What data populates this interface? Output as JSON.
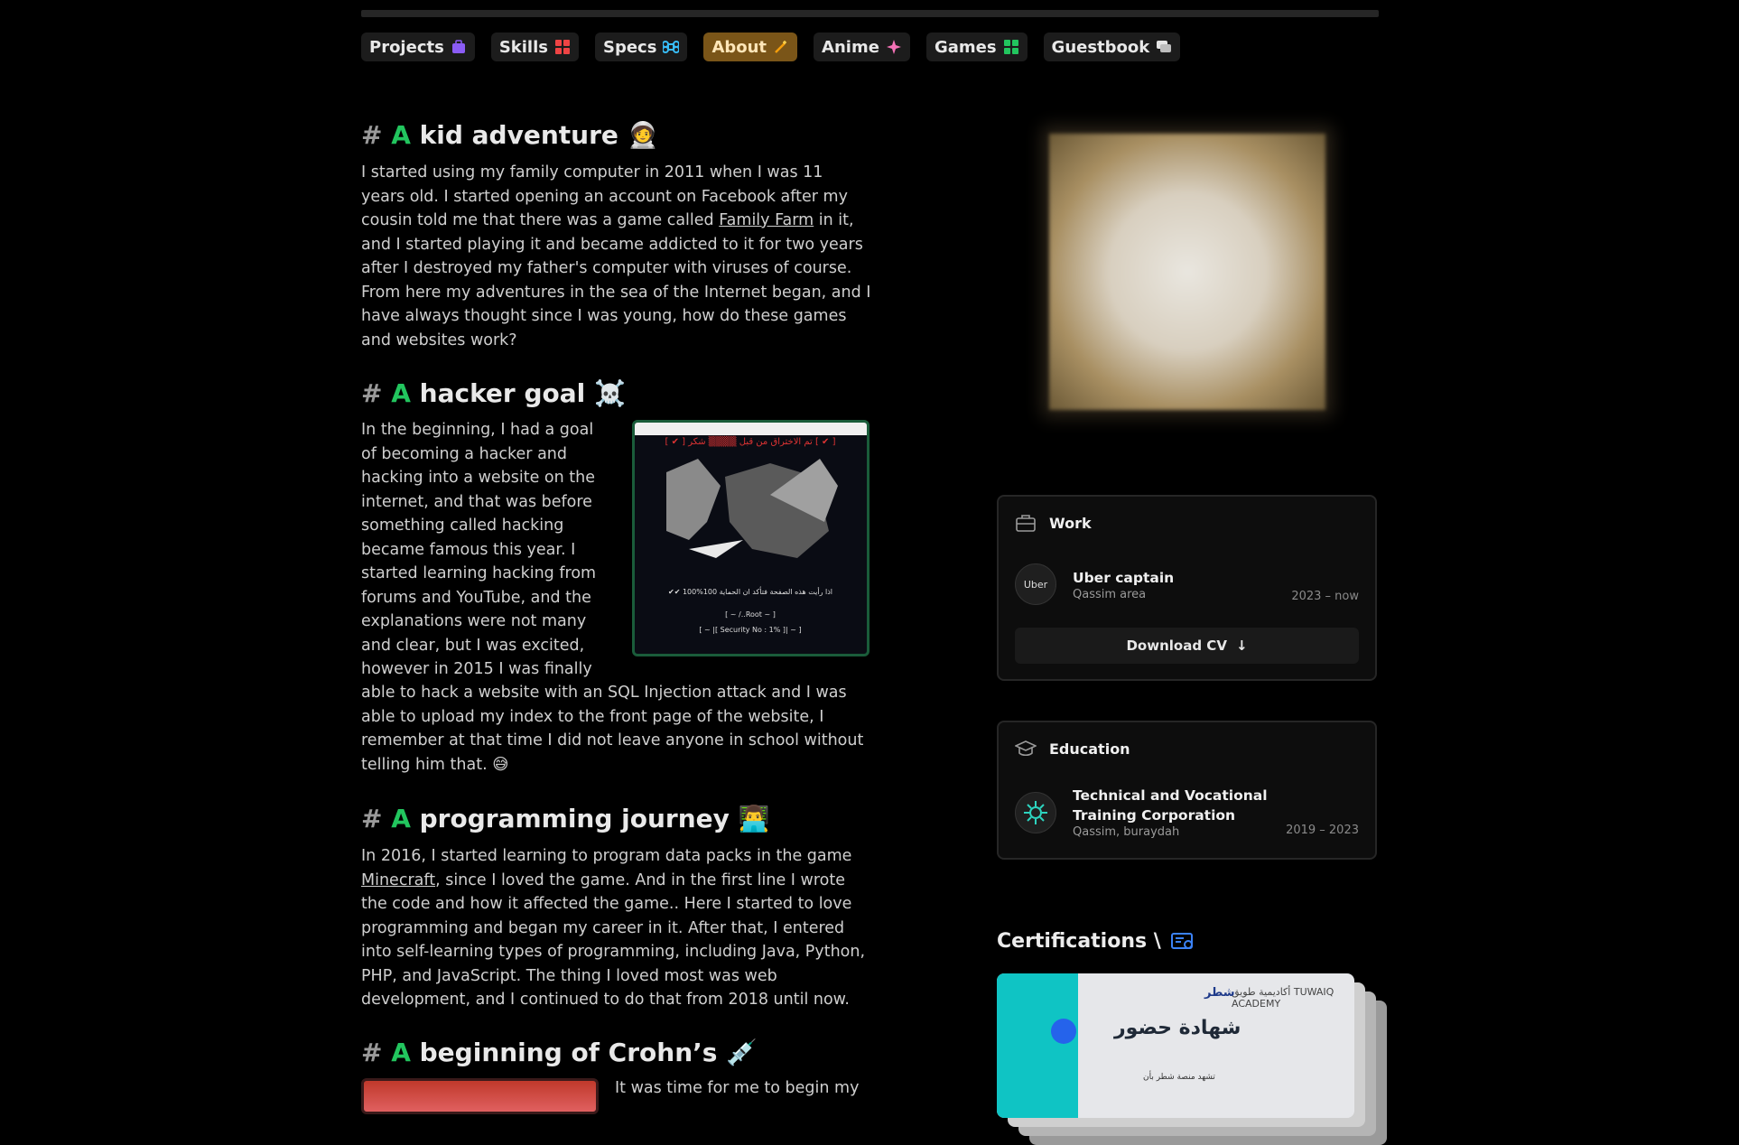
{
  "nav": {
    "items": [
      {
        "label": "Projects",
        "icon": "briefcase-purple-icon",
        "active": false
      },
      {
        "label": "Skills",
        "icon": "grid-red-icon",
        "active": false
      },
      {
        "label": "Specs",
        "icon": "command-blue-icon",
        "active": false
      },
      {
        "label": "About",
        "icon": "wand-orange-icon",
        "active": true
      },
      {
        "label": "Anime",
        "icon": "sparkle-pink-icon",
        "active": false
      },
      {
        "label": "Games",
        "icon": "grid-green-icon",
        "active": false
      },
      {
        "label": "Guestbook",
        "icon": "chat-icon",
        "active": false
      }
    ]
  },
  "sections": [
    {
      "hash": "#",
      "a": "A",
      "title": "kid adventure",
      "emoji": "🧑‍🚀",
      "text_before": "I started using my family computer in 2011 when I was 11 years old. I started opening an account on Facebook after my cousin told me that there was a game called ",
      "link": "Family Farm",
      "text_after": " in it, and I started playing it and became addicted to it for two years after I destroyed my father's computer with viruses of course. From here my adventures in the sea of the Internet began, and I have always thought since I was young, how do these games and websites work?"
    },
    {
      "hash": "#",
      "a": "A",
      "title": "hacker goal",
      "emoji": "☠️",
      "text": "In the beginning, I had a goal of becoming a hacker and hacking into a website on the internet, and that was before something called hacking became famous this year. I started learning hacking from forums and YouTube, and the explanations were not many and clear, but I was excited, however in 2015 I was finally",
      "text2": "able to hack a website with an SQL Injection attack and I was able to upload my index to the front page of the website, I remember at that time I did not leave anyone in school without telling him that. 😅",
      "image_lines": [
        "[ ✔ ] تم الاختراق من قبل ▒▒▒▒ شكر [ ✔ ]",
        "✔✔ 100%100 اذا رأيت هذه الصفحة فتأكد ان الحماية",
        "[ ~ /..Root ~ ]",
        "[ ~ |[ Security No : 1% ]| ~ ]"
      ]
    },
    {
      "hash": "#",
      "a": "A",
      "title": "programming journey",
      "emoji": "👨‍💻",
      "text_before": "In 2016, I started learning to program data packs in the game ",
      "link": "Minecraft",
      "text_after": ", since I loved the game. And in the first line I wrote the code and how it affected the game.. Here I started to love programming and began my career in it. After that, I entered into self-learning types of programming, including Java, Python, PHP, and JavaScript. The thing I loved most was web development, and I continued to do that from 2018 until now."
    },
    {
      "hash": "#",
      "a": "A",
      "title": "beginning of Crohn’s",
      "emoji": "💉",
      "text": "It was time for me to begin my"
    }
  ],
  "work": {
    "heading": "Work",
    "company_logo": "Uber",
    "role": "Uber captain",
    "location": "Qassim area",
    "dates": "2023 – now",
    "button": "Download CV",
    "button_icon": "↓"
  },
  "education": {
    "heading": "Education",
    "school": "Technical and Vocational Training Corporation",
    "location": "Qassim, buraydah",
    "dates": "2019 – 2023"
  },
  "certifications": {
    "title": "Certifications \\",
    "card_title": "شهادة حضور",
    "card_sub": "تشهد منصة شطر بأن",
    "card_brand": "شطر",
    "card_academy": "أكاديمية طويق TUWAIQ ACADEMY"
  }
}
